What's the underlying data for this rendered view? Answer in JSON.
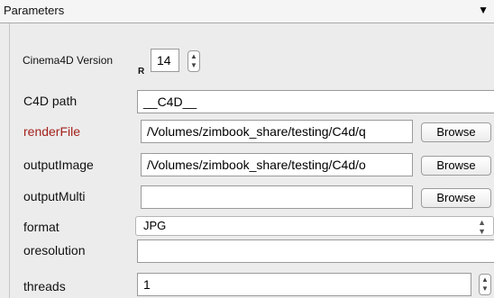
{
  "panel": {
    "title": "Parameters",
    "collapse_icon": "▼"
  },
  "version": {
    "label": "Cinema4D Version",
    "prefix": "R",
    "value": "14"
  },
  "rows": {
    "c4d_path": {
      "label": "C4D path",
      "value": "__C4D__"
    },
    "render_file": {
      "label": "renderFile",
      "value": "/Volumes/zimbook_share/testing/C4d/q",
      "browse": "Browse"
    },
    "output_image": {
      "label": "outputImage",
      "value": "/Volumes/zimbook_share/testing/C4d/o",
      "browse": "Browse"
    },
    "output_multi": {
      "label": "outputMulti",
      "value": "",
      "browse": "Browse"
    },
    "format": {
      "label": "format",
      "selected": "JPG"
    },
    "oresolution": {
      "label": "oresolution",
      "value": ""
    },
    "threads": {
      "label": "threads",
      "value": "1"
    }
  },
  "colors": {
    "required_label": "#a3211c",
    "background": "#ececec"
  }
}
